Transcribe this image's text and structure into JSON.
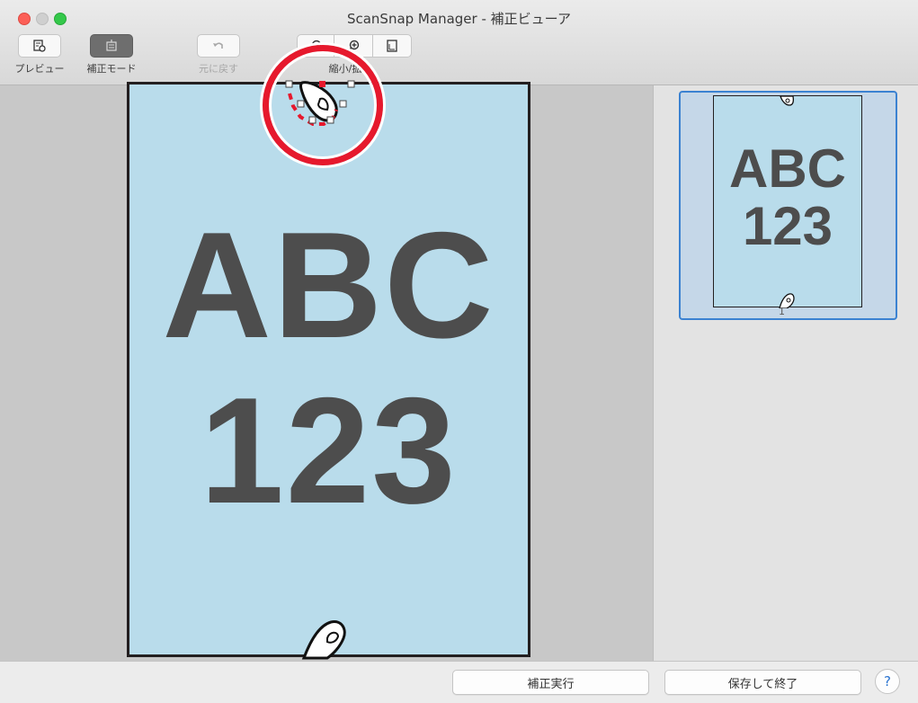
{
  "window": {
    "title": "ScanSnap Manager - 補正ビューア"
  },
  "toolbar": {
    "preview_label": "プレビュー",
    "correction_mode_label": "補正モード",
    "undo_label": "元に戻す",
    "zoom_label": "縮小/拡"
  },
  "document": {
    "line1": "ABC",
    "line2": "123"
  },
  "thumbnail": {
    "line1": "ABC",
    "line2": "123",
    "page_number": "1"
  },
  "footer": {
    "apply_button": "補正実行",
    "save_exit_button": "保存して終了",
    "help_label": "?"
  },
  "colors": {
    "page_background": "#b9dceb",
    "highlight": "#e6192d",
    "selection_border": "#3b82d1"
  }
}
